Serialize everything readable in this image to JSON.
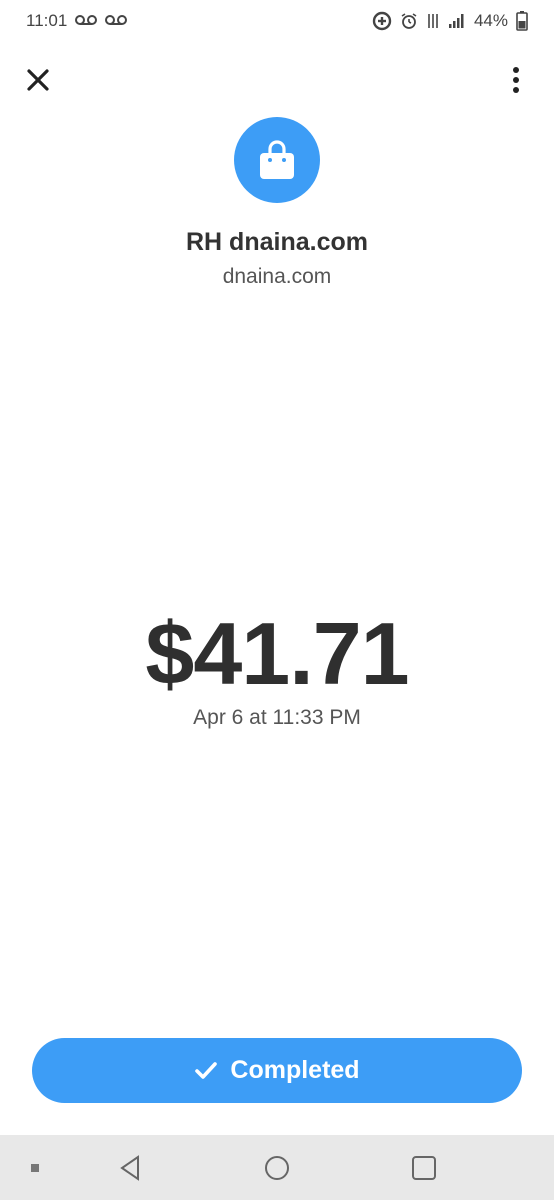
{
  "status_bar": {
    "time": "11:01",
    "voicemail_icons": [
      "voicemail-icon",
      "voicemail-icon"
    ],
    "battery": "44%",
    "icons": [
      "data-saver-icon",
      "alarm-icon",
      "wifi-calling-icon",
      "signal-icon",
      "battery-icon"
    ]
  },
  "header": {
    "close_icon": "close-icon",
    "more_icon": "more-vertical-icon"
  },
  "merchant": {
    "icon": "shopping-bag-icon",
    "name": "RH dnaina.com",
    "domain": "dnaina.com"
  },
  "transaction": {
    "amount": "$41.71",
    "date": "Apr 6 at 11:33 PM"
  },
  "status_button": {
    "icon": "check-icon",
    "label": "Completed"
  },
  "colors": {
    "accent": "#3d9df6",
    "text": "#333333",
    "nav_background": "#e8e8e8"
  },
  "nav": [
    "recent-apps-indicator",
    "back-icon",
    "home-icon",
    "overview-icon"
  ]
}
